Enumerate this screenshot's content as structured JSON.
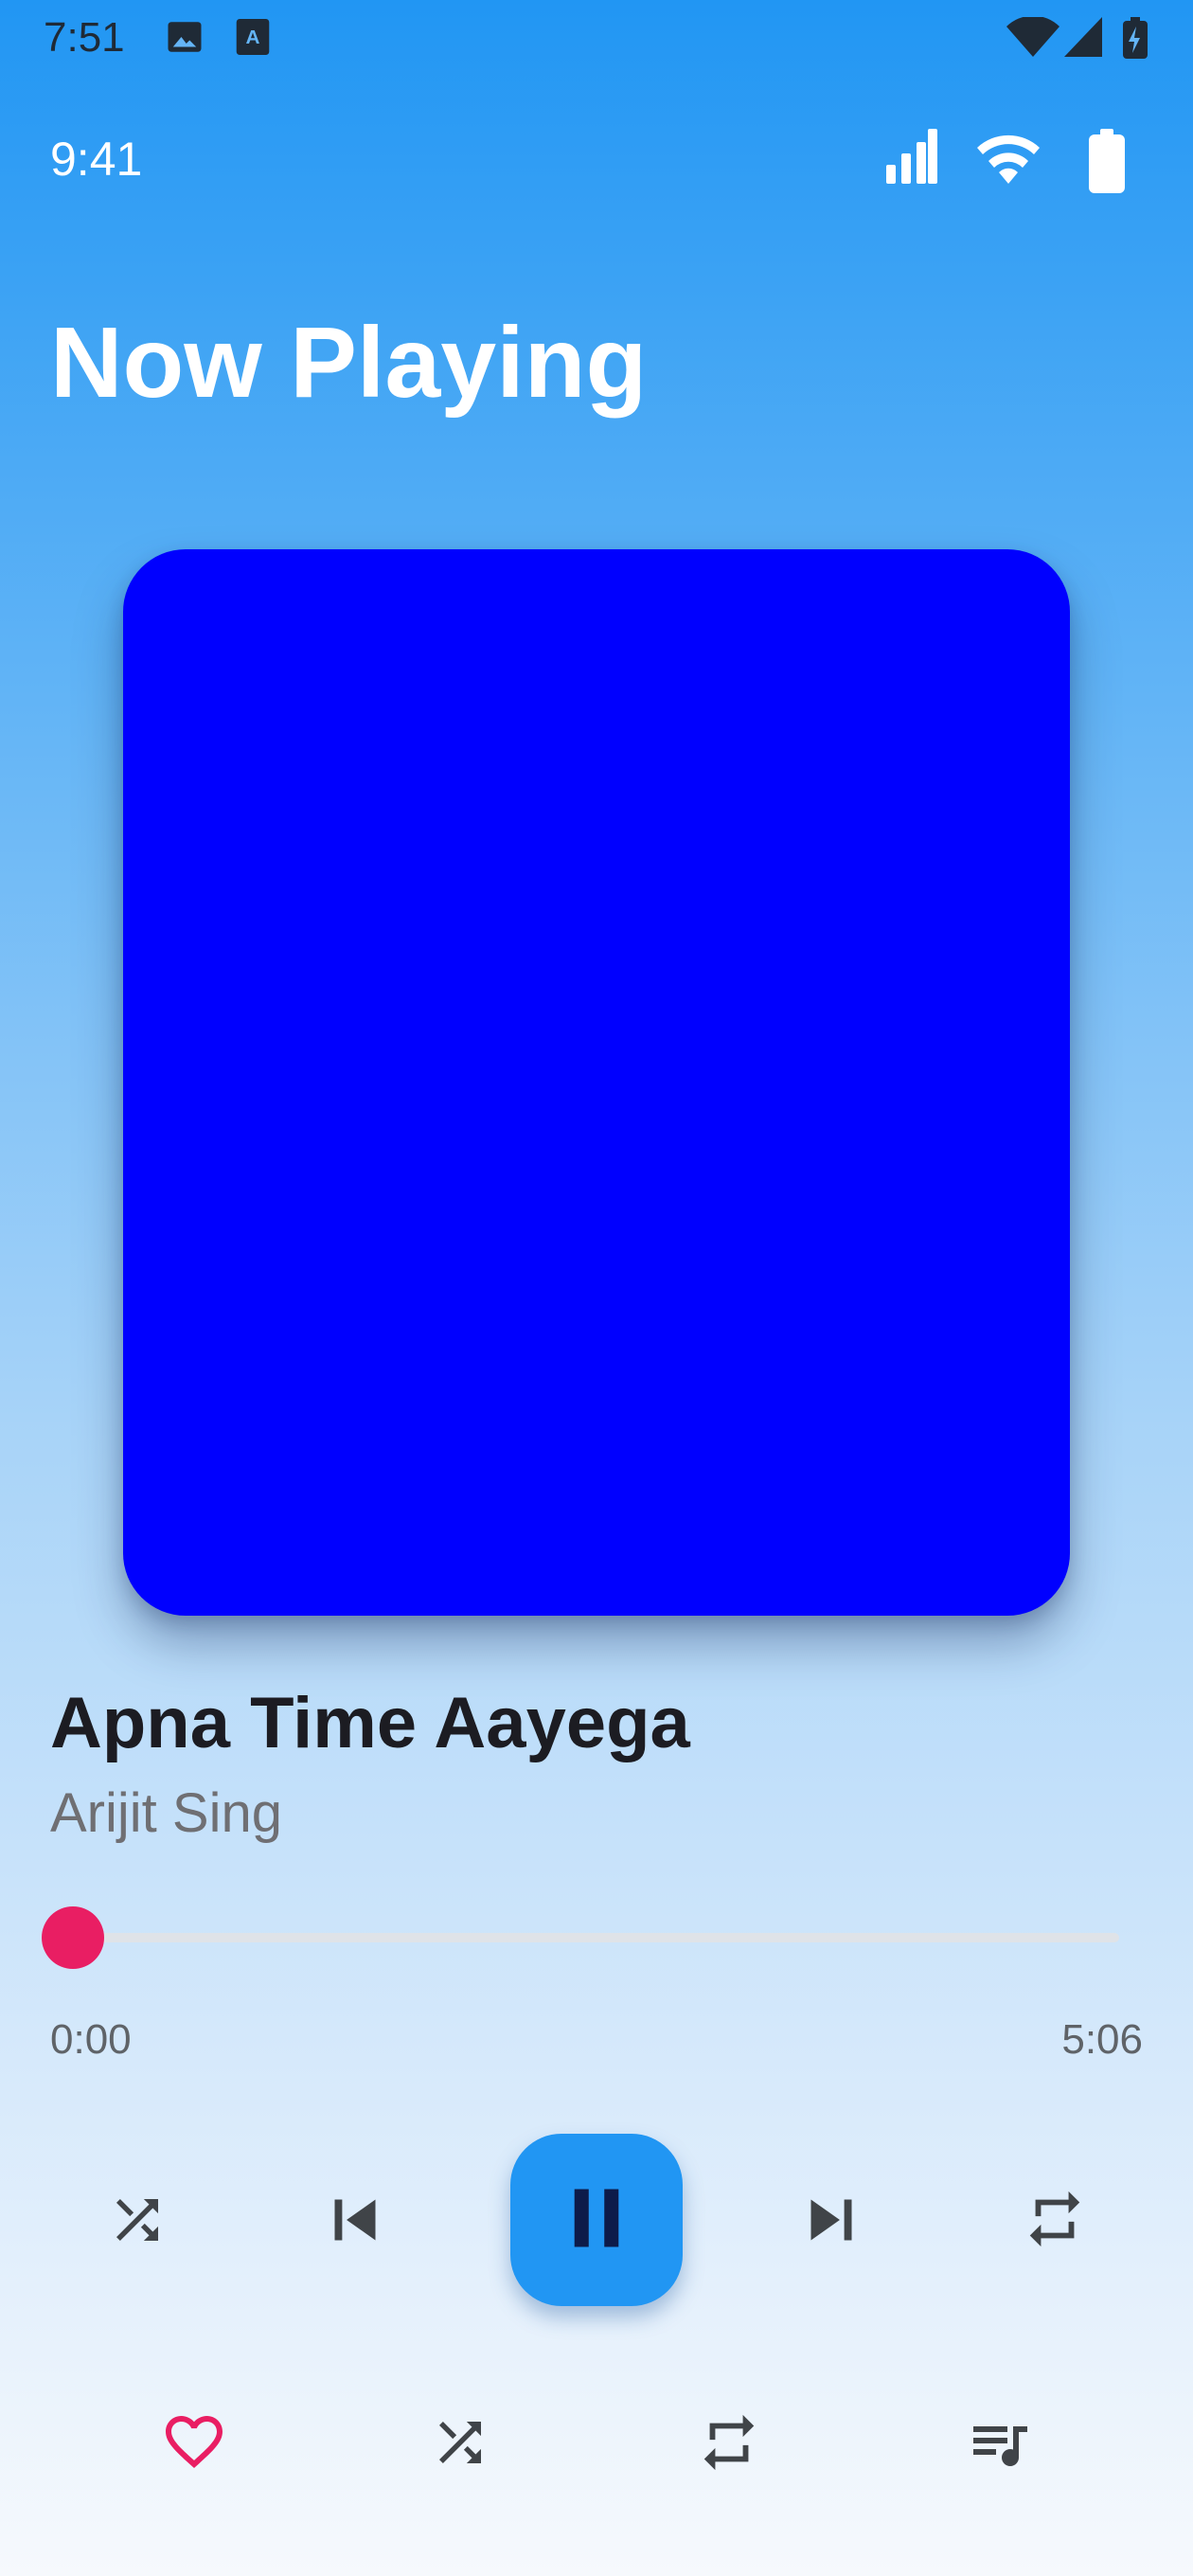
{
  "system_bar": {
    "time": "7:51",
    "icons": [
      "image-icon",
      "text-a-icon",
      "wifi-icon",
      "signal-icon",
      "battery-charging-icon"
    ]
  },
  "app_status": {
    "time": "9:41",
    "icons": [
      "signal-icon",
      "wifi-icon",
      "battery-icon"
    ]
  },
  "header": {
    "title": "Now Playing"
  },
  "album": {
    "color": "#0000ff"
  },
  "track": {
    "title": "Apna Time Aayega",
    "artist": "Arijit Sing"
  },
  "progress": {
    "current": "0:00",
    "total": "5:06",
    "fraction": 0.0
  },
  "controls": {
    "icons": [
      "shuffle-icon",
      "skip-previous-icon",
      "pause-icon",
      "skip-next-icon",
      "repeat-icon"
    ]
  },
  "actions": {
    "icons": [
      "heart-outline-icon",
      "shuffle-icon",
      "repeat-icon",
      "playlist-icon"
    ]
  },
  "colors": {
    "accent": "#2196f3",
    "seek": "#e91e63",
    "heart": "#e91e63",
    "icon": "#404448"
  }
}
